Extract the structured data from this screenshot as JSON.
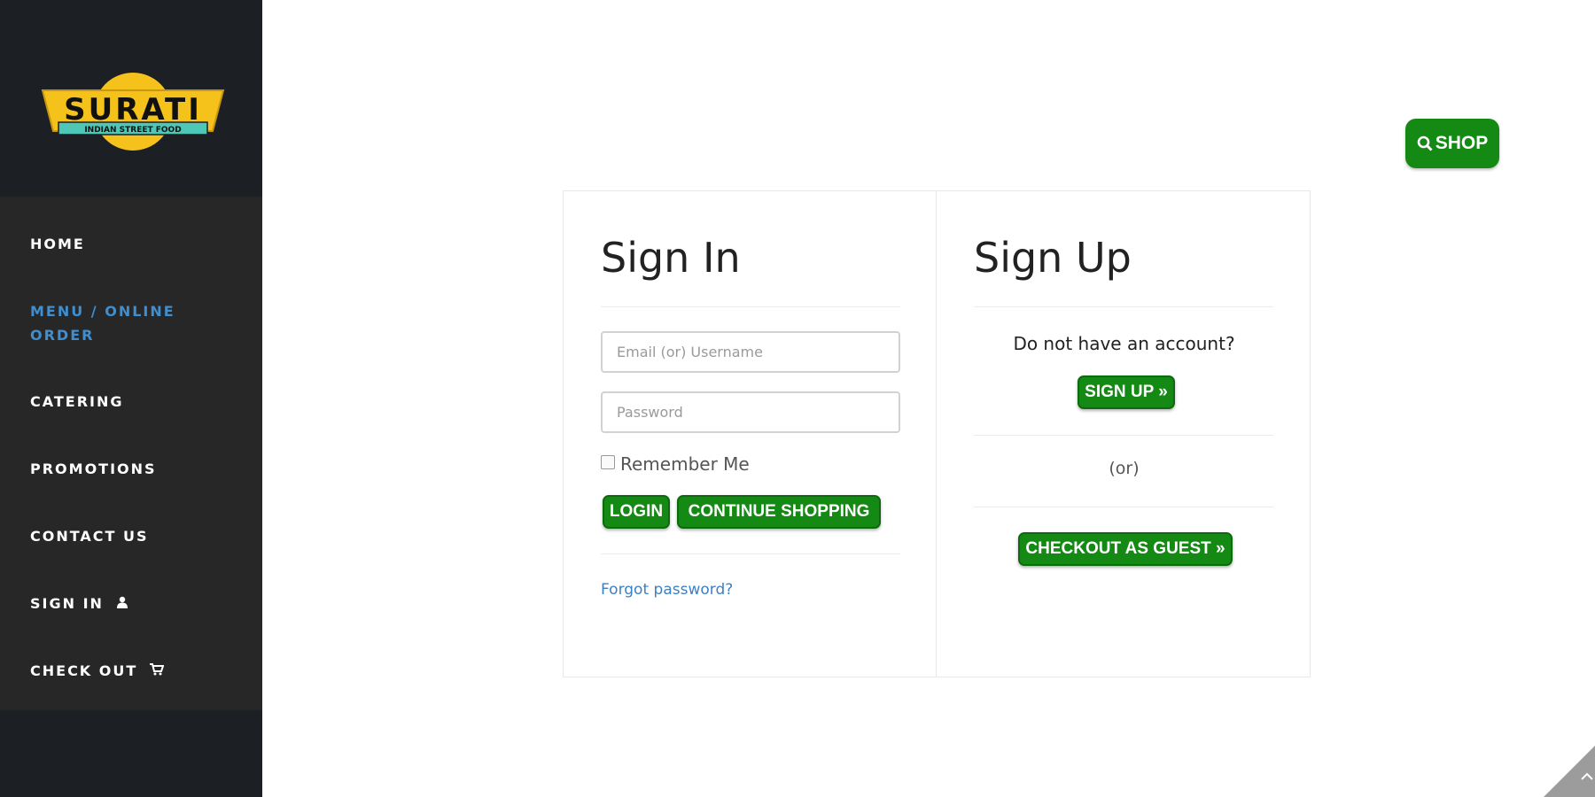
{
  "brand": {
    "name": "SURATI",
    "tagline": "INDIAN STREET FOOD"
  },
  "nav": {
    "items": [
      {
        "label": "HOME",
        "icon": ""
      },
      {
        "label": "MENU / ONLINE ORDER",
        "icon": "",
        "active": true
      },
      {
        "label": "CATERING",
        "icon": ""
      },
      {
        "label": "PROMOTIONS",
        "icon": ""
      },
      {
        "label": "CONTACT US",
        "icon": ""
      },
      {
        "label": "SIGN IN",
        "icon": "user-icon"
      },
      {
        "label": "CHECK OUT",
        "icon": "cart-icon"
      }
    ]
  },
  "header": {
    "shop_label": "SHOP",
    "shop_icon": "search-icon"
  },
  "signin": {
    "title": "Sign In",
    "email_placeholder": "Email (or) Username",
    "password_placeholder": "Password",
    "remember_label": "Remember Me",
    "login_label": "LOGIN",
    "continue_label": "CONTINUE SHOPPING",
    "forgot_label": "Forgot password?"
  },
  "signup": {
    "title": "Sign Up",
    "prompt": "Do not have an account?",
    "signup_label": "SIGN UP »",
    "or_label": "(or)",
    "guest_label": "CHECKOUT AS GUEST »"
  },
  "colors": {
    "sidebar_bg": "#1c1f23",
    "nav_bg": "#272727",
    "nav_active": "#3f8fd0",
    "button_green": "#148a14",
    "link_blue": "#3d7fc4",
    "logo_yellow": "#f5c21b",
    "logo_teal": "#4fc7b6"
  }
}
